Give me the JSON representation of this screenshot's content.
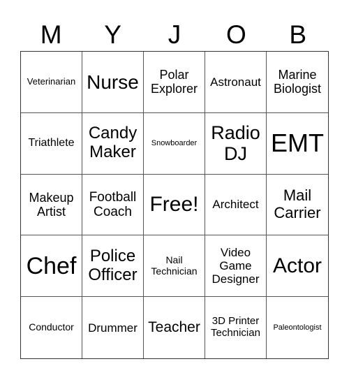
{
  "card": {
    "header": [
      "M",
      "Y",
      "J",
      "O",
      "B"
    ],
    "rows": [
      [
        "Veterinarian",
        "Nurse",
        "Polar Explorer",
        "Astronaut",
        "Marine Biologist"
      ],
      [
        "Triathlete",
        "Candy Maker",
        "Snowboarder",
        "Radio DJ",
        "EMT"
      ],
      [
        "Makeup Artist",
        "Football Coach",
        "Free!",
        "Architect",
        "Mail Carrier"
      ],
      [
        "Chef",
        "Police Officer",
        "Nail Technician",
        "Video Game Designer",
        "Actor"
      ],
      [
        "Conductor",
        "Drummer",
        "Teacher",
        "3D Printer Technician",
        "Paleontologist"
      ]
    ]
  }
}
